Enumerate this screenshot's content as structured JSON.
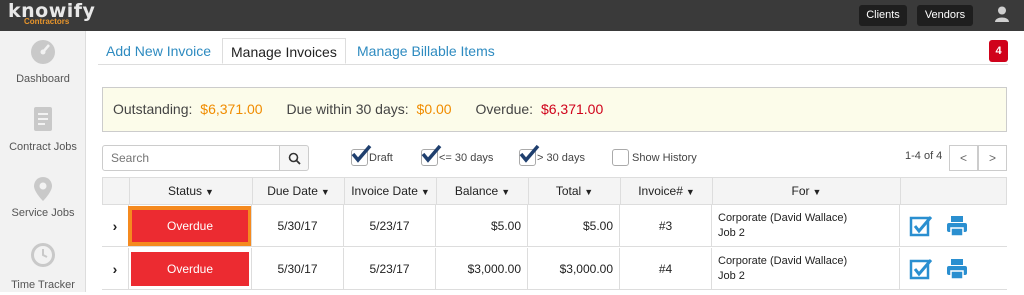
{
  "topbar": {
    "logo_text": "knowify",
    "logo_sub": "Contractors",
    "clients_label": "Clients",
    "vendors_label": "Vendors"
  },
  "sidebar": {
    "items": [
      {
        "label": "Dashboard",
        "icon": "dashboard-icon"
      },
      {
        "label": "Contract Jobs",
        "icon": "contract-icon"
      },
      {
        "label": "Service Jobs",
        "icon": "location-pin-icon"
      },
      {
        "label": "Time Tracker",
        "icon": "clock-icon"
      }
    ]
  },
  "tabs": {
    "add": "Add New Invoice",
    "manage": "Manage Invoices",
    "billable": "Manage Billable Items"
  },
  "notification_count": "4",
  "summary": {
    "outstanding_label": "Outstanding:",
    "outstanding_value": "$6,371.00",
    "due_label": "Due within 30 days:",
    "due_value": "$0.00",
    "overdue_label": "Overdue:",
    "overdue_value": "$6,371.00"
  },
  "search": {
    "placeholder": "Search"
  },
  "filters": {
    "draft": "Draft",
    "le30": "<= 30 days",
    "gt30": "> 30 days",
    "history": "Show History"
  },
  "pager": {
    "text": "1-4 of 4",
    "prev": "<",
    "next": ">"
  },
  "table": {
    "headers": {
      "status": "Status",
      "due": "Due Date",
      "invoice_date": "Invoice Date",
      "balance": "Balance",
      "total": "Total",
      "invoice_no": "Invoice#",
      "for": "For"
    },
    "rows": [
      {
        "status": "Overdue",
        "due": "5/30/17",
        "invoice_date": "5/23/17",
        "balance": "$5.00",
        "total": "$5.00",
        "invoice_no": "#3",
        "for_line1": "Corporate (David Wallace)",
        "for_line2": "Job 2"
      },
      {
        "status": "Overdue",
        "due": "5/30/17",
        "invoice_date": "5/23/17",
        "balance": "$3,000.00",
        "total": "$3,000.00",
        "invoice_no": "#4",
        "for_line1": "Corporate (David Wallace)",
        "for_line2": "Job 2"
      }
    ]
  },
  "colors": {
    "accent": "#2e8bc0",
    "overdue": "#ec2b31",
    "orange": "#f08c00",
    "badge": "#d0021b"
  }
}
